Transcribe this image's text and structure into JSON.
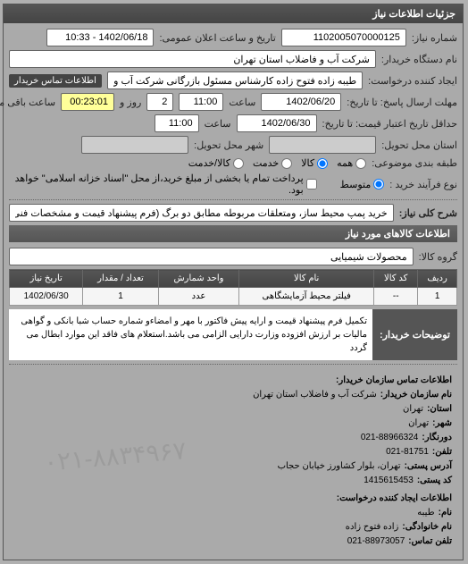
{
  "header": {
    "title": "جزئیات اطلاعات نیاز"
  },
  "fields": {
    "request_no_label": "شماره نیاز:",
    "request_no": "1102005070000125",
    "announce_date_label": "تاریخ و ساعت اعلان عمومی:",
    "announce_date": "1402/06/18 - 10:33",
    "buyer_org_label": "نام دستگاه خریدار:",
    "buyer_org": "شرکت آب و فاضلاب استان تهران",
    "creator_label": "ایجاد کننده درخواست:",
    "creator": "طیبه زاده فتوح زاده کارشناس مسئول بازرگانی شرکت آب و فاضلاب استان تهرا",
    "contact_link": "اطلاعات تماس خریدار",
    "deadline_label": "مهلت ارسال پاسخ: تا تاریخ:",
    "deadline_date": "1402/06/20",
    "deadline_time_label": "ساعت",
    "deadline_time": "11:00",
    "deadline_days_label": "روز و",
    "deadline_days": "2",
    "remaining_label": "ساعت باقی مانده",
    "remaining_time": "00:23:01",
    "validity_label": "حداقل تاریخ اعتبار قیمت: تا تاریخ:",
    "validity_date": "1402/06/30",
    "validity_time": "11:00",
    "delivery_state_label": "استان محل تحویل:",
    "delivery_city_label": "شهر محل تحویل:",
    "classification_label": "طبقه بندی موضوعی:",
    "buy_type_label": "نوع فرآیند خرید :",
    "radio_all": "همه",
    "radio_goods": "کالا",
    "radio_service": "خدمت",
    "radio_goods_service": "کالا/خدمت",
    "radio_medium": "متوسط",
    "checkbox_partial": "پرداخت تمام یا بخشی از مبلغ خرید،از محل \"اسناد خزانه اسلامی\" خواهد بود.",
    "description_label": "شرح کلی نیاز:",
    "description": "خرید پمپ محیط ساز، ومتعلقات مربوطه مطابق دو برگ (فرم پیشنهاد قیمت و مشخصات فنی )پیوست سامانه"
  },
  "goods_section": {
    "title": "اطلاعات کالاهای مورد نیاز",
    "group_label": "گروه کالا:",
    "group_value": "محصولات شیمیایی"
  },
  "table": {
    "headers": {
      "row": "ردیف",
      "code": "کد کالا",
      "name": "نام کالا",
      "unit": "واحد شمارش",
      "qty": "تعداد / مقدار",
      "date": "تاریخ نیاز"
    },
    "rows": [
      {
        "row": "1",
        "code": "--",
        "name": "فیلتر محیط آزمایشگاهی",
        "unit": "عدد",
        "qty": "1",
        "date": "1402/06/30"
      }
    ]
  },
  "notes": {
    "label": "توضیحات خریدار:",
    "content": "تکمیل فرم پیشنهاد قیمت و ارایه پیش فاکتور با مهر و امضاءو شماره حساب شبا بانکی و گواهی مالیات بر ارزش افزوده وزارت دارایی الزامی می باشد.استعلام های فاقد این موارد ابطال می گردد"
  },
  "contact": {
    "title": "اطلاعات تماس سازمان خریدار:",
    "org_label": "نام سازمان خریدار:",
    "org_value": "شرکت آب و فاضلاب استان تهران",
    "province_label": "استان:",
    "province_value": "تهران",
    "city_label": "شهر:",
    "city_value": "تهران",
    "fax_label": "دورنگار:",
    "fax_value": "021-88966324",
    "phone_label": "تلفن:",
    "phone_value": "021-81751",
    "address_label": "آدرس پستی:",
    "address_value": "تهران، بلوار کشاورز خیابان حجاب",
    "postal_label": "کد پستی:",
    "postal_value": "1415615453",
    "creator_title": "اطلاعات ایجاد کننده درخواست:",
    "creator_name_label": "نام:",
    "creator_name_value": "طیبه",
    "creator_surname_label": "نام خانوادگی:",
    "creator_surname_value": "زاده فتوح زاده",
    "creator_phone_label": "تلفن تماس:",
    "creator_phone_value": "021-88973057"
  },
  "watermark": "۰۲۱-۸۸۳۴۹۶۷"
}
